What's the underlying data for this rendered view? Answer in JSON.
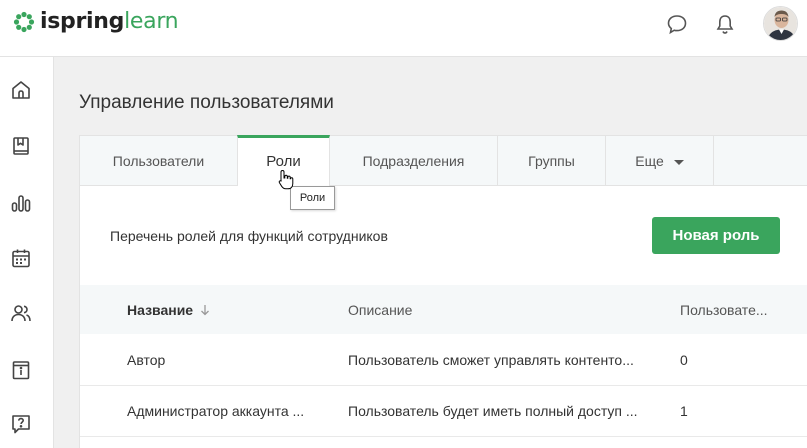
{
  "header": {
    "logo_primary": "ispring",
    "logo_secondary": "learn",
    "icons": [
      "chat-icon",
      "bell-icon"
    ],
    "avatar_alt": "user-avatar"
  },
  "sidebar": {
    "items": [
      {
        "icon": "home-icon"
      },
      {
        "icon": "book-icon"
      },
      {
        "icon": "reports-icon"
      },
      {
        "icon": "calendar-icon"
      },
      {
        "icon": "users-icon"
      },
      {
        "icon": "info-icon"
      },
      {
        "icon": "help-icon"
      }
    ]
  },
  "page": {
    "title": "Управление пользователями"
  },
  "tabs": [
    {
      "label": "Пользователи",
      "active": false
    },
    {
      "label": "Роли",
      "active": true
    },
    {
      "label": "Подразделения",
      "active": false
    },
    {
      "label": "Группы",
      "active": false
    },
    {
      "label": "Еще",
      "active": false
    }
  ],
  "roles": {
    "description": "Перечень ролей для функций сотрудников",
    "new_button": "Новая роль",
    "columns": {
      "name": "Название",
      "description": "Описание",
      "users": "Пользовате..."
    },
    "rows": [
      {
        "name": "Автор",
        "description": "Пользователь сможет управлять контенто...",
        "users": "0"
      },
      {
        "name": "Администратор аккаунта ...",
        "description": "Пользователь будет иметь полный доступ ...",
        "users": "1"
      }
    ]
  },
  "tooltip": {
    "text": "Роли"
  },
  "colors": {
    "accent": "#3aa55d",
    "tab_bg": "#f5f8f9",
    "page_bg": "#f0f0f0"
  }
}
